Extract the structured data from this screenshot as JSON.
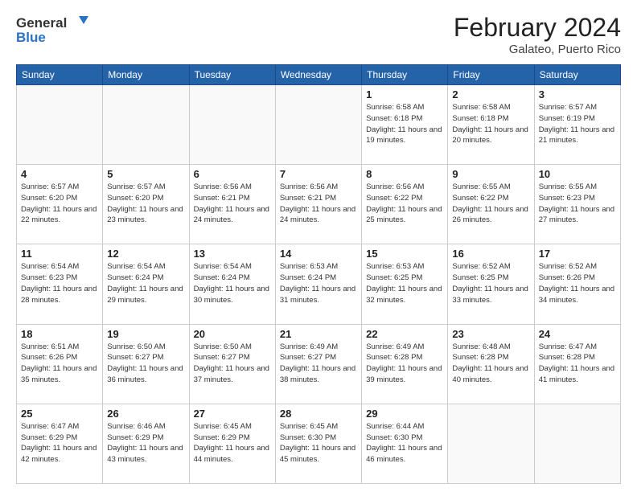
{
  "header": {
    "logo_general": "General",
    "logo_blue": "Blue",
    "month_title": "February 2024",
    "location": "Galateo, Puerto Rico"
  },
  "weekdays": [
    "Sunday",
    "Monday",
    "Tuesday",
    "Wednesday",
    "Thursday",
    "Friday",
    "Saturday"
  ],
  "weeks": [
    [
      {
        "day": "",
        "info": ""
      },
      {
        "day": "",
        "info": ""
      },
      {
        "day": "",
        "info": ""
      },
      {
        "day": "",
        "info": ""
      },
      {
        "day": "1",
        "info": "Sunrise: 6:58 AM\nSunset: 6:18 PM\nDaylight: 11 hours and 19 minutes."
      },
      {
        "day": "2",
        "info": "Sunrise: 6:58 AM\nSunset: 6:18 PM\nDaylight: 11 hours and 20 minutes."
      },
      {
        "day": "3",
        "info": "Sunrise: 6:57 AM\nSunset: 6:19 PM\nDaylight: 11 hours and 21 minutes."
      }
    ],
    [
      {
        "day": "4",
        "info": "Sunrise: 6:57 AM\nSunset: 6:20 PM\nDaylight: 11 hours and 22 minutes."
      },
      {
        "day": "5",
        "info": "Sunrise: 6:57 AM\nSunset: 6:20 PM\nDaylight: 11 hours and 23 minutes."
      },
      {
        "day": "6",
        "info": "Sunrise: 6:56 AM\nSunset: 6:21 PM\nDaylight: 11 hours and 24 minutes."
      },
      {
        "day": "7",
        "info": "Sunrise: 6:56 AM\nSunset: 6:21 PM\nDaylight: 11 hours and 24 minutes."
      },
      {
        "day": "8",
        "info": "Sunrise: 6:56 AM\nSunset: 6:22 PM\nDaylight: 11 hours and 25 minutes."
      },
      {
        "day": "9",
        "info": "Sunrise: 6:55 AM\nSunset: 6:22 PM\nDaylight: 11 hours and 26 minutes."
      },
      {
        "day": "10",
        "info": "Sunrise: 6:55 AM\nSunset: 6:23 PM\nDaylight: 11 hours and 27 minutes."
      }
    ],
    [
      {
        "day": "11",
        "info": "Sunrise: 6:54 AM\nSunset: 6:23 PM\nDaylight: 11 hours and 28 minutes."
      },
      {
        "day": "12",
        "info": "Sunrise: 6:54 AM\nSunset: 6:24 PM\nDaylight: 11 hours and 29 minutes."
      },
      {
        "day": "13",
        "info": "Sunrise: 6:54 AM\nSunset: 6:24 PM\nDaylight: 11 hours and 30 minutes."
      },
      {
        "day": "14",
        "info": "Sunrise: 6:53 AM\nSunset: 6:24 PM\nDaylight: 11 hours and 31 minutes."
      },
      {
        "day": "15",
        "info": "Sunrise: 6:53 AM\nSunset: 6:25 PM\nDaylight: 11 hours and 32 minutes."
      },
      {
        "day": "16",
        "info": "Sunrise: 6:52 AM\nSunset: 6:25 PM\nDaylight: 11 hours and 33 minutes."
      },
      {
        "day": "17",
        "info": "Sunrise: 6:52 AM\nSunset: 6:26 PM\nDaylight: 11 hours and 34 minutes."
      }
    ],
    [
      {
        "day": "18",
        "info": "Sunrise: 6:51 AM\nSunset: 6:26 PM\nDaylight: 11 hours and 35 minutes."
      },
      {
        "day": "19",
        "info": "Sunrise: 6:50 AM\nSunset: 6:27 PM\nDaylight: 11 hours and 36 minutes."
      },
      {
        "day": "20",
        "info": "Sunrise: 6:50 AM\nSunset: 6:27 PM\nDaylight: 11 hours and 37 minutes."
      },
      {
        "day": "21",
        "info": "Sunrise: 6:49 AM\nSunset: 6:27 PM\nDaylight: 11 hours and 38 minutes."
      },
      {
        "day": "22",
        "info": "Sunrise: 6:49 AM\nSunset: 6:28 PM\nDaylight: 11 hours and 39 minutes."
      },
      {
        "day": "23",
        "info": "Sunrise: 6:48 AM\nSunset: 6:28 PM\nDaylight: 11 hours and 40 minutes."
      },
      {
        "day": "24",
        "info": "Sunrise: 6:47 AM\nSunset: 6:28 PM\nDaylight: 11 hours and 41 minutes."
      }
    ],
    [
      {
        "day": "25",
        "info": "Sunrise: 6:47 AM\nSunset: 6:29 PM\nDaylight: 11 hours and 42 minutes."
      },
      {
        "day": "26",
        "info": "Sunrise: 6:46 AM\nSunset: 6:29 PM\nDaylight: 11 hours and 43 minutes."
      },
      {
        "day": "27",
        "info": "Sunrise: 6:45 AM\nSunset: 6:29 PM\nDaylight: 11 hours and 44 minutes."
      },
      {
        "day": "28",
        "info": "Sunrise: 6:45 AM\nSunset: 6:30 PM\nDaylight: 11 hours and 45 minutes."
      },
      {
        "day": "29",
        "info": "Sunrise: 6:44 AM\nSunset: 6:30 PM\nDaylight: 11 hours and 46 minutes."
      },
      {
        "day": "",
        "info": ""
      },
      {
        "day": "",
        "info": ""
      }
    ]
  ]
}
